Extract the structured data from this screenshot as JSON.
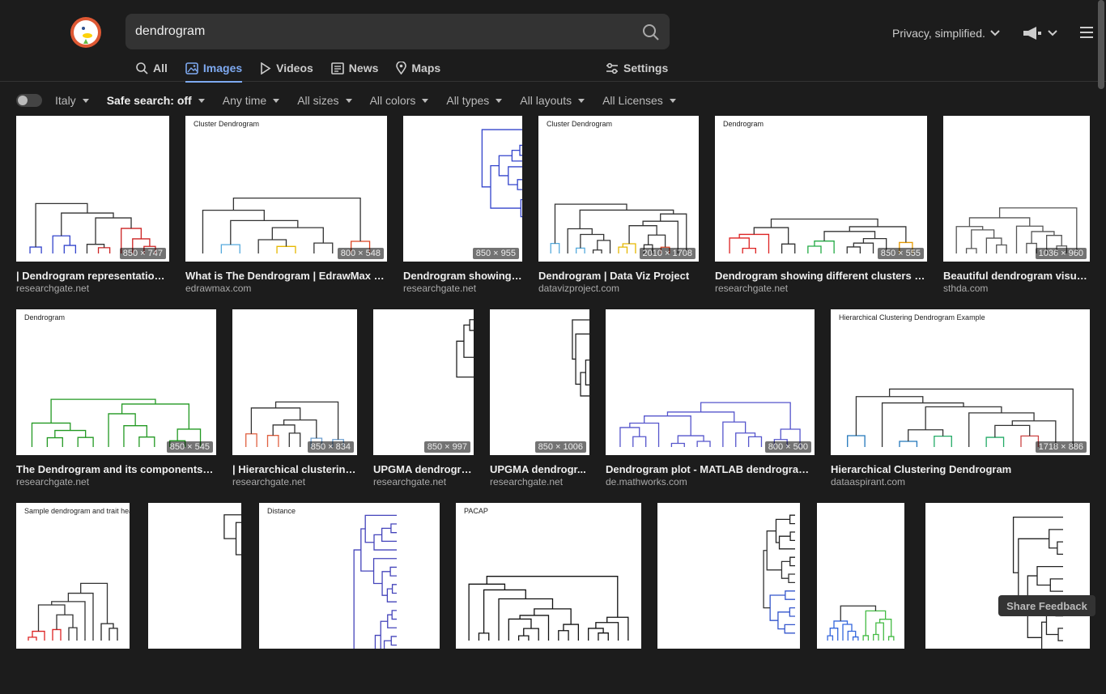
{
  "search": {
    "query": "dendrogram"
  },
  "header": {
    "privacy_label": "Privacy, simplified."
  },
  "tabs": [
    {
      "label": "All",
      "icon": "search-icon"
    },
    {
      "label": "Images",
      "icon": "image-icon"
    },
    {
      "label": "Videos",
      "icon": "play-icon"
    },
    {
      "label": "News",
      "icon": "news-icon"
    },
    {
      "label": "Maps",
      "icon": "map-pin-icon"
    }
  ],
  "settings_label": "Settings",
  "filters": {
    "region": "Italy",
    "safe_search": "Safe search: off",
    "time": "Any time",
    "size": "All sizes",
    "color": "All colors",
    "type": "All types",
    "layout": "All layouts",
    "license": "All Licenses"
  },
  "results": [
    {
      "title": "| Dendrogram representation ...",
      "source": "researchgate.net",
      "dims": "850 × 747",
      "thumb_text": "",
      "colors": [
        "#3344cc",
        "#cc2222"
      ]
    },
    {
      "title": "What is The Dendrogram | EdrawMax O...",
      "source": "edrawmax.com",
      "dims": "800 × 548",
      "thumb_text": "Cluster Dendrogram",
      "colors": [
        "#55aadd",
        "#e6b800",
        "#dd4422"
      ]
    },
    {
      "title": "Dendrogram showing t...",
      "source": "researchgate.net",
      "dims": "850 × 955",
      "thumb_text": "",
      "colors": [
        "#3344cc",
        "#3344cc"
      ]
    },
    {
      "title": "Dendrogram | Data Viz Project",
      "source": "datavizproject.com",
      "dims": "2010 × 1708",
      "thumb_text": "Cluster Dendrogram",
      "colors": [
        "#55aadd",
        "#e6b800",
        "#dd4422"
      ]
    },
    {
      "title": "Dendrogram showing different clusters an...",
      "source": "researchgate.net",
      "dims": "850 × 555",
      "thumb_text": "Dendrogram",
      "colors": [
        "#dd2222",
        "#22aa44",
        "#e69900"
      ]
    },
    {
      "title": "Beautiful dendrogram visual...",
      "source": "sthda.com",
      "dims": "1036 × 960",
      "thumb_text": "",
      "colors": [
        "#555555",
        "#555555"
      ]
    },
    {
      "title": "The Dendrogram and its components. | ...",
      "source": "researchgate.net",
      "dims": "850 × 545",
      "thumb_text": "Dendrogram",
      "colors": [
        "#229922",
        "#229922"
      ]
    },
    {
      "title": "| Hierarchical clustering ...",
      "source": "researchgate.net",
      "dims": "850 × 834",
      "thumb_text": "",
      "colors": [
        "#e06040",
        "#6fa0d0"
      ]
    },
    {
      "title": "UPGMA dendrogra...",
      "source": "researchgate.net",
      "dims": "850 × 997",
      "thumb_text": "",
      "colors": [
        "#222222",
        "#222222"
      ]
    },
    {
      "title": "UPGMA dendrogr...",
      "source": "researchgate.net",
      "dims": "850 × 1006",
      "thumb_text": "",
      "colors": [
        "#222222",
        "#222222"
      ]
    },
    {
      "title": "Dendrogram plot - MATLAB dendrogram ...",
      "source": "de.mathworks.com",
      "dims": "800 × 500",
      "thumb_text": "",
      "colors": [
        "#5555cc",
        "#5555cc"
      ]
    },
    {
      "title": "Hierarchical Clustering Dendrogram",
      "source": "dataaspirant.com",
      "dims": "1718 × 886",
      "thumb_text": "Hierarchical Clustering Dendrogram Example",
      "colors": [
        "#2277bb",
        "#22aa66",
        "#cc4444"
      ]
    },
    {
      "title": "",
      "source": "",
      "dims": "",
      "thumb_text": "Sample dendrogram and trait heatmap",
      "colors": [
        "#dd2222",
        "#222222"
      ]
    },
    {
      "title": "",
      "source": "",
      "dims": "",
      "thumb_text": "",
      "colors": [
        "#222222",
        "#222222"
      ]
    },
    {
      "title": "",
      "source": "",
      "dims": "",
      "thumb_text": "Distance",
      "colors": [
        "#4444bb",
        "#4444bb"
      ]
    },
    {
      "title": "",
      "source": "",
      "dims": "",
      "thumb_text": "PACAP",
      "colors": [
        "#111111",
        "#111111"
      ]
    },
    {
      "title": "",
      "source": "",
      "dims": "",
      "thumb_text": "",
      "colors": [
        "#222222",
        "#3355cc"
      ]
    },
    {
      "title": "",
      "source": "",
      "dims": "",
      "thumb_text": "",
      "colors": [
        "#3366dd",
        "#44bb44"
      ]
    },
    {
      "title": "",
      "source": "",
      "dims": "",
      "thumb_text": "",
      "colors": [
        "#222222",
        "#222222"
      ]
    }
  ],
  "feedback_label": "Share Feedback"
}
